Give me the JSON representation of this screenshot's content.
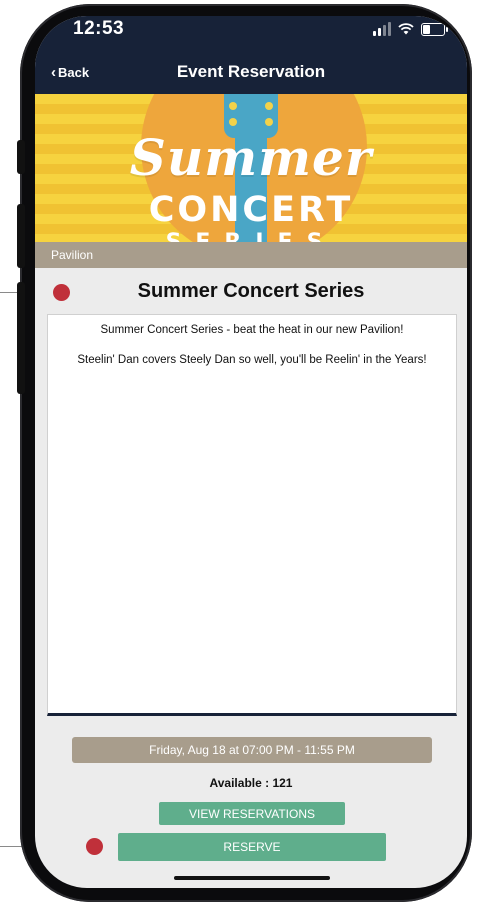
{
  "status_bar": {
    "time": "12:53"
  },
  "nav": {
    "back_label": "Back",
    "title": "Event Reservation"
  },
  "banner": {
    "script_text": "Summer",
    "concert_text": "CONCERT",
    "series_text": "SERIES"
  },
  "event": {
    "location": "Pavilion",
    "title": "Summer Concert Series",
    "description": [
      "Summer Concert Series - beat the heat in our new Pavilion!",
      "Steelin' Dan covers Steely Dan so well, you'll be Reelin' in the Years!"
    ],
    "datetime": "Friday, Aug 18 at 07:00 PM - 11:55 PM",
    "available": "Available : 121"
  },
  "actions": {
    "view_reservations": "VIEW RESERVATIONS",
    "reserve": "RESERVE"
  },
  "colors": {
    "nav_bg": "#172238",
    "accent_green": "#5fae8c",
    "taupe": "#a89d8c",
    "callout_dot": "#c0303a"
  }
}
